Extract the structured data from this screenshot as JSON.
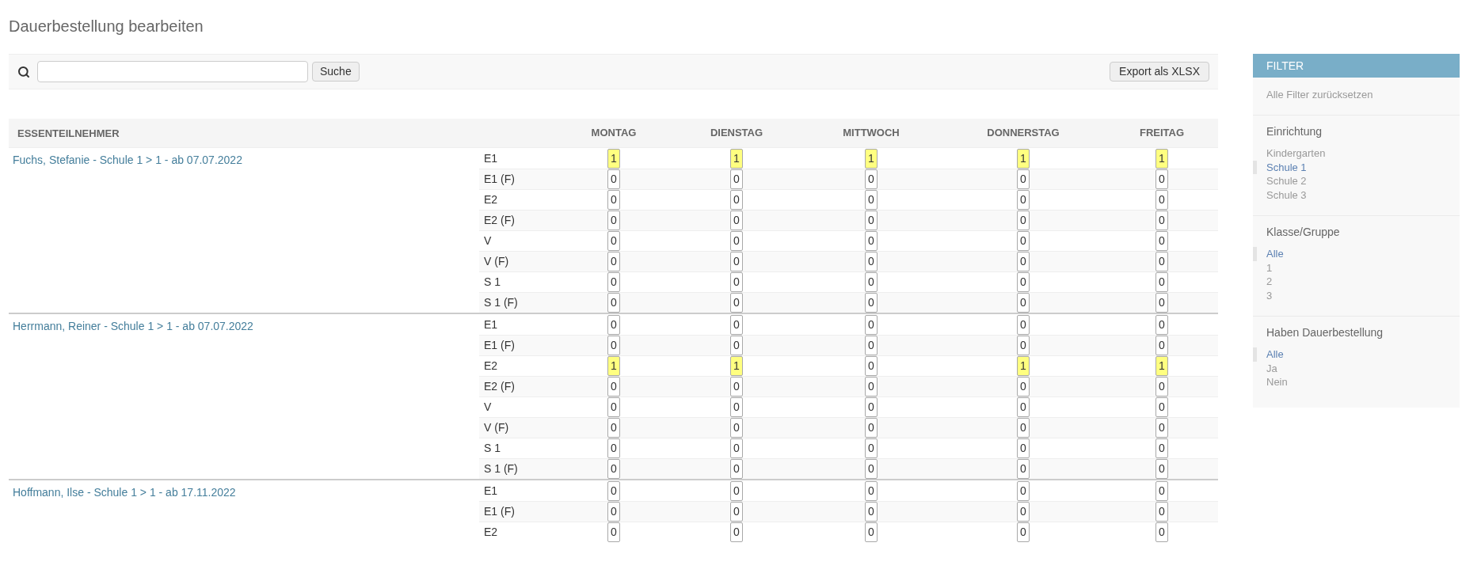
{
  "page": {
    "title": "Dauerbestellung bearbeiten"
  },
  "toolbar": {
    "search_button": "Suche",
    "export_button": "Export als XLSX"
  },
  "table": {
    "participant_column": "ESSENTEILNEHMER",
    "day_columns": [
      "MONTAG",
      "DIENSTAG",
      "MITTWOCH",
      "DONNERSTAG",
      "FREITAG"
    ],
    "participants": [
      {
        "name": "Fuchs, Stefanie - Schule 1 > 1 - ab 07.07.2022",
        "meals": [
          {
            "label": "E1",
            "values": [
              "1",
              "1",
              "1",
              "1",
              "1"
            ],
            "highlighted": [
              true,
              true,
              true,
              true,
              true
            ]
          },
          {
            "label": "E1 (F)",
            "values": [
              "0",
              "0",
              "0",
              "0",
              "0"
            ],
            "highlighted": [
              false,
              false,
              false,
              false,
              false
            ]
          },
          {
            "label": "E2",
            "values": [
              "0",
              "0",
              "0",
              "0",
              "0"
            ],
            "highlighted": [
              false,
              false,
              false,
              false,
              false
            ]
          },
          {
            "label": "E2 (F)",
            "values": [
              "0",
              "0",
              "0",
              "0",
              "0"
            ],
            "highlighted": [
              false,
              false,
              false,
              false,
              false
            ]
          },
          {
            "label": "V",
            "values": [
              "0",
              "0",
              "0",
              "0",
              "0"
            ],
            "highlighted": [
              false,
              false,
              false,
              false,
              false
            ]
          },
          {
            "label": "V (F)",
            "values": [
              "0",
              "0",
              "0",
              "0",
              "0"
            ],
            "highlighted": [
              false,
              false,
              false,
              false,
              false
            ]
          },
          {
            "label": "S 1",
            "values": [
              "0",
              "0",
              "0",
              "0",
              "0"
            ],
            "highlighted": [
              false,
              false,
              false,
              false,
              false
            ]
          },
          {
            "label": "S 1 (F)",
            "values": [
              "0",
              "0",
              "0",
              "0",
              "0"
            ],
            "highlighted": [
              false,
              false,
              false,
              false,
              false
            ]
          }
        ]
      },
      {
        "name": "Herrmann, Reiner - Schule 1 > 1 - ab 07.07.2022",
        "meals": [
          {
            "label": "E1",
            "values": [
              "0",
              "0",
              "0",
              "0",
              "0"
            ],
            "highlighted": [
              false,
              false,
              false,
              false,
              false
            ]
          },
          {
            "label": "E1 (F)",
            "values": [
              "0",
              "0",
              "0",
              "0",
              "0"
            ],
            "highlighted": [
              false,
              false,
              false,
              false,
              false
            ]
          },
          {
            "label": "E2",
            "values": [
              "1",
              "1",
              "0",
              "1",
              "1"
            ],
            "highlighted": [
              true,
              true,
              false,
              true,
              true
            ]
          },
          {
            "label": "E2 (F)",
            "values": [
              "0",
              "0",
              "0",
              "0",
              "0"
            ],
            "highlighted": [
              false,
              false,
              false,
              false,
              false
            ]
          },
          {
            "label": "V",
            "values": [
              "0",
              "0",
              "0",
              "0",
              "0"
            ],
            "highlighted": [
              false,
              false,
              false,
              false,
              false
            ]
          },
          {
            "label": "V (F)",
            "values": [
              "0",
              "0",
              "0",
              "0",
              "0"
            ],
            "highlighted": [
              false,
              false,
              false,
              false,
              false
            ]
          },
          {
            "label": "S 1",
            "values": [
              "0",
              "0",
              "0",
              "0",
              "0"
            ],
            "highlighted": [
              false,
              false,
              false,
              false,
              false
            ]
          },
          {
            "label": "S 1 (F)",
            "values": [
              "0",
              "0",
              "0",
              "0",
              "0"
            ],
            "highlighted": [
              false,
              false,
              false,
              false,
              false
            ]
          }
        ]
      },
      {
        "name": "Hoffmann, Ilse - Schule 1 > 1 - ab 17.11.2022",
        "meals": [
          {
            "label": "E1",
            "values": [
              "0",
              "0",
              "0",
              "0",
              "0"
            ],
            "highlighted": [
              false,
              false,
              false,
              false,
              false
            ]
          },
          {
            "label": "E1 (F)",
            "values": [
              "0",
              "0",
              "0",
              "0",
              "0"
            ],
            "highlighted": [
              false,
              false,
              false,
              false,
              false
            ]
          },
          {
            "label": "E2",
            "values": [
              "0",
              "0",
              "0",
              "0",
              "0"
            ],
            "highlighted": [
              false,
              false,
              false,
              false,
              false
            ]
          }
        ]
      }
    ]
  },
  "filter": {
    "title": "FILTER",
    "reset": "Alle Filter zurücksetzen",
    "groups": [
      {
        "title": "Einrichtung",
        "options": [
          {
            "label": "Kindergarten",
            "selected": false
          },
          {
            "label": "Schule 1",
            "selected": true
          },
          {
            "label": "Schule 2",
            "selected": false
          },
          {
            "label": "Schule 3",
            "selected": false
          }
        ]
      },
      {
        "title": "Klasse/Gruppe",
        "options": [
          {
            "label": "Alle",
            "selected": true
          },
          {
            "label": "1",
            "selected": false
          },
          {
            "label": "2",
            "selected": false
          },
          {
            "label": "3",
            "selected": false
          }
        ]
      },
      {
        "title": "Haben Dauerbestellung",
        "options": [
          {
            "label": "Alle",
            "selected": true
          },
          {
            "label": "Ja",
            "selected": false
          },
          {
            "label": "Nein",
            "selected": false
          }
        ]
      }
    ]
  }
}
